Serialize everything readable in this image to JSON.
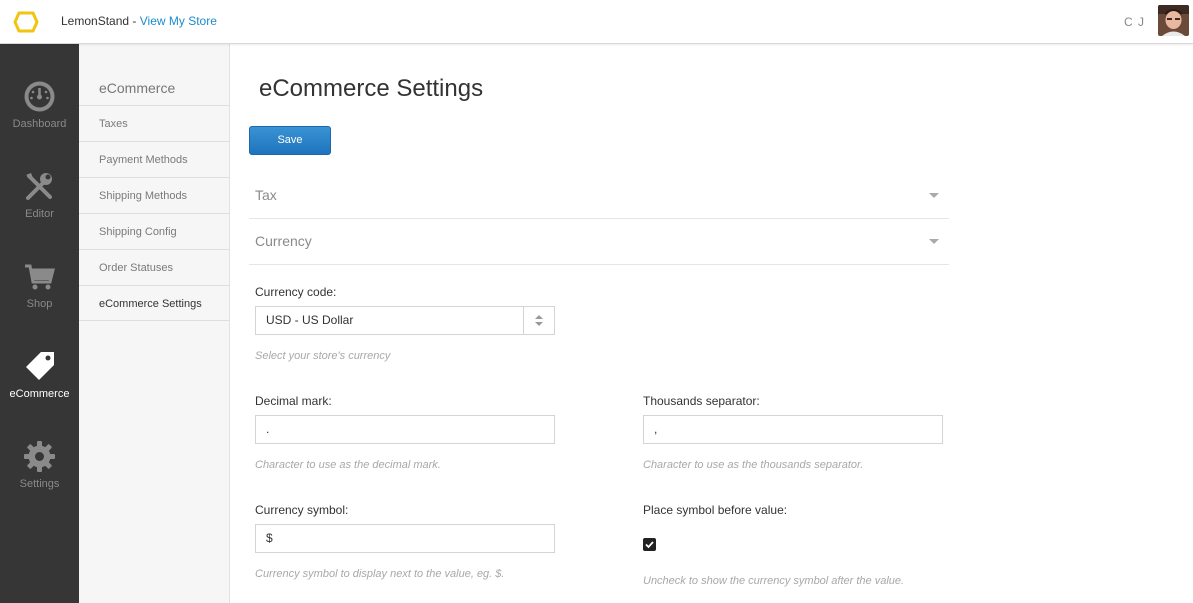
{
  "header": {
    "brand_name": "LemonStand",
    "brand_sep": " - ",
    "store_link": "View My Store",
    "user_initials": "C J"
  },
  "leftnav": [
    {
      "label": "Dashboard",
      "icon": "gauge-icon"
    },
    {
      "label": "Editor",
      "icon": "tools-icon"
    },
    {
      "label": "Shop",
      "icon": "cart-icon"
    },
    {
      "label": "eCommerce",
      "icon": "tag-icon",
      "active": true
    },
    {
      "label": "Settings",
      "icon": "gear-icon"
    }
  ],
  "subnav": {
    "title": "eCommerce",
    "items": [
      "Taxes",
      "Payment Methods",
      "Shipping Methods",
      "Shipping Config",
      "Order Statuses",
      "eCommerce Settings"
    ],
    "active": "eCommerce Settings"
  },
  "page": {
    "title": "eCommerce Settings",
    "save_label": "Save"
  },
  "sections": {
    "tax": "Tax",
    "currency": "Currency"
  },
  "form": {
    "currency_code": {
      "label": "Currency code:",
      "value": "USD - US Dollar",
      "help": "Select your store's currency"
    },
    "decimal_mark": {
      "label": "Decimal mark:",
      "value": ".",
      "help": "Character to use as the decimal mark."
    },
    "thousands_separator": {
      "label": "Thousands separator:",
      "value": ",",
      "help": "Character to use as the thousands separator."
    },
    "currency_symbol": {
      "label": "Currency symbol:",
      "value": "$",
      "help": "Currency symbol to display next to the value, eg. $."
    },
    "symbol_before": {
      "label": "Place symbol before value:",
      "checked": true,
      "help": "Uncheck to show the currency symbol after the value."
    }
  },
  "colors": {
    "accent": "#1a8ccf",
    "button": "#2a83c8",
    "sidebar": "#363636",
    "logo": "#f1c40f"
  }
}
